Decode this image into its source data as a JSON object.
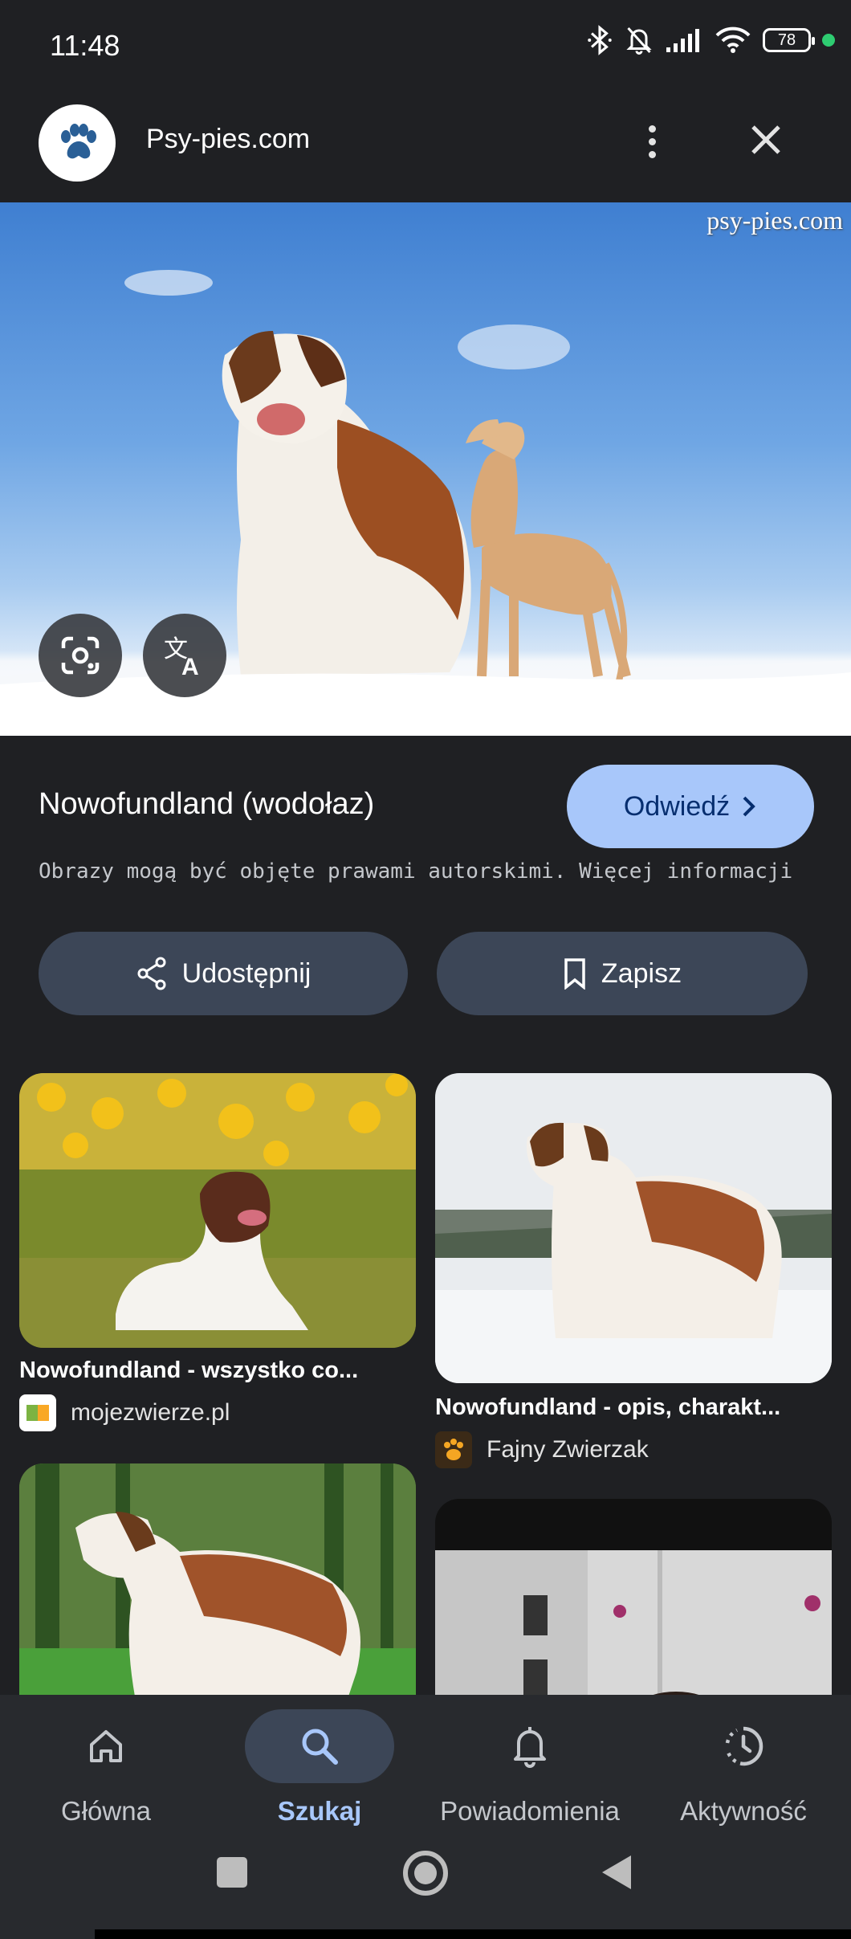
{
  "status_bar": {
    "time": "11:48",
    "battery": "78"
  },
  "top_bar": {
    "site_title": "Psy-pies.com"
  },
  "hero": {
    "watermark": "psy-pies.com"
  },
  "result": {
    "title": "Nowofundland (wodołaz)",
    "visit_label": "Odwiedź",
    "copyright_note": "Obrazy mogą być objęte prawami autorskimi. Więcej informacji"
  },
  "actions": {
    "share_label": "Udostępnij",
    "save_label": "Zapisz"
  },
  "related": [
    {
      "title": "Nowofundland - wszystko co...",
      "source": "mojezwierze.pl"
    },
    {
      "title": "Nowofundland - opis, charakt...",
      "source": "Fajny Zwierzak"
    }
  ],
  "bottom_nav": {
    "items": [
      {
        "label": "Główna",
        "icon": "home-icon"
      },
      {
        "label": "Szukaj",
        "icon": "search-icon"
      },
      {
        "label": "Powiadomienia",
        "icon": "bell-icon"
      },
      {
        "label": "Aktywność",
        "icon": "activity-icon"
      }
    ],
    "active": "Szukaj"
  },
  "colors": {
    "accent": "#a8c7fa",
    "background": "#1f2023",
    "pill": "#3c4657"
  }
}
